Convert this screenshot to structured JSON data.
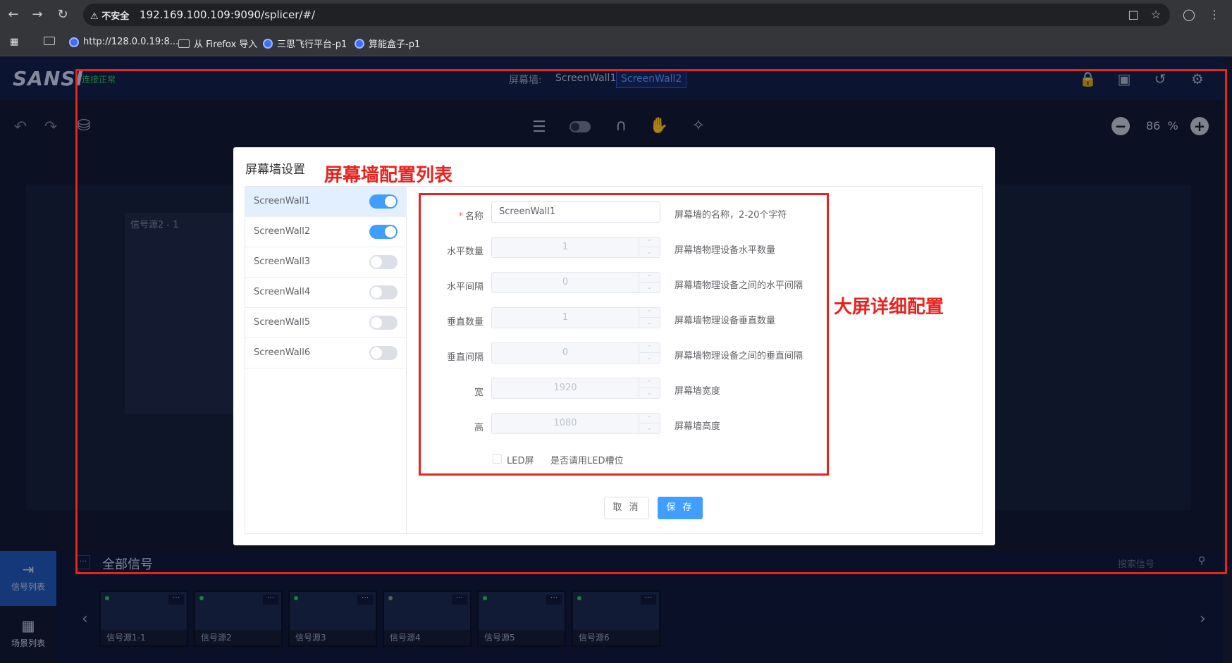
{
  "browser": {
    "security_label": "不安全",
    "url": "192.169.100.109:9090/splicer/#/",
    "bookmarks": [
      {
        "label": "http://128.0.0.19:8..."
      },
      {
        "label": "从 Firefox 导入"
      },
      {
        "label": "三思飞行平台-p1"
      },
      {
        "label": "算能盒子-p1"
      }
    ]
  },
  "header": {
    "logo": "SANSI",
    "connection_status": "连接正常",
    "wall_label": "屏幕墙:",
    "wall_tabs": [
      "ScreenWall1",
      "ScreenWall2"
    ],
    "active_wall_tab": "ScreenWall2",
    "zoom_value": "86",
    "zoom_unit": "%"
  },
  "workspace": {
    "source_block_label": "信号源2 - 1"
  },
  "bottom": {
    "dots": "···",
    "all_signals_title": "全部信号",
    "search_placeholder": "搜索信号",
    "rail_items": [
      {
        "label": "信号列表",
        "active": true
      },
      {
        "label": "场景列表",
        "active": false
      }
    ],
    "sources": [
      {
        "label": "信号源1-1",
        "status_color": "#2ec45c"
      },
      {
        "label": "信号源2",
        "status_color": "#2ec45c"
      },
      {
        "label": "信号源3",
        "status_color": "#2ec45c"
      },
      {
        "label": "信号源4",
        "status_color": "#8a8f9c"
      },
      {
        "label": "信号源5",
        "status_color": "#2ec45c"
      },
      {
        "label": "信号源6",
        "status_color": "#2ec45c"
      }
    ]
  },
  "modal": {
    "title": "屏幕墙设置",
    "walls": [
      {
        "name": "ScreenWall1",
        "enabled": true,
        "selected": true
      },
      {
        "name": "ScreenWall2",
        "enabled": true,
        "selected": false
      },
      {
        "name": "ScreenWall3",
        "enabled": false,
        "selected": false
      },
      {
        "name": "ScreenWall4",
        "enabled": false,
        "selected": false
      },
      {
        "name": "ScreenWall5",
        "enabled": false,
        "selected": false
      },
      {
        "name": "ScreenWall6",
        "enabled": false,
        "selected": false
      }
    ],
    "form": {
      "name": {
        "label": "名称",
        "required": "*",
        "value": "ScreenWall1",
        "hint": "屏幕墙的名称，2-20个字符"
      },
      "h_count": {
        "label": "水平数量",
        "value": "1",
        "hint": "屏幕墙物理设备水平数量"
      },
      "h_gap": {
        "label": "水平间隔",
        "value": "0",
        "hint": "屏幕墙物理设备之间的水平间隔"
      },
      "v_count": {
        "label": "垂直数量",
        "value": "1",
        "hint": "屏幕墙物理设备垂直数量"
      },
      "v_gap": {
        "label": "垂直间隔",
        "value": "0",
        "hint": "屏幕墙物理设备之间的垂直间隔"
      },
      "width": {
        "label": "宽",
        "value": "1920",
        "hint": "屏幕墙宽度"
      },
      "height": {
        "label": "高",
        "value": "1080",
        "hint": "屏幕墙高度"
      },
      "led": {
        "label": "LED屏",
        "checked": false,
        "hint": "是否请用LED槽位"
      }
    },
    "cancel_label": "取 消",
    "save_label": "保 存"
  },
  "annotations": {
    "list_note": "屏幕墙配置列表",
    "detail_note": "大屏详细配置",
    "color": "#e8231e"
  }
}
